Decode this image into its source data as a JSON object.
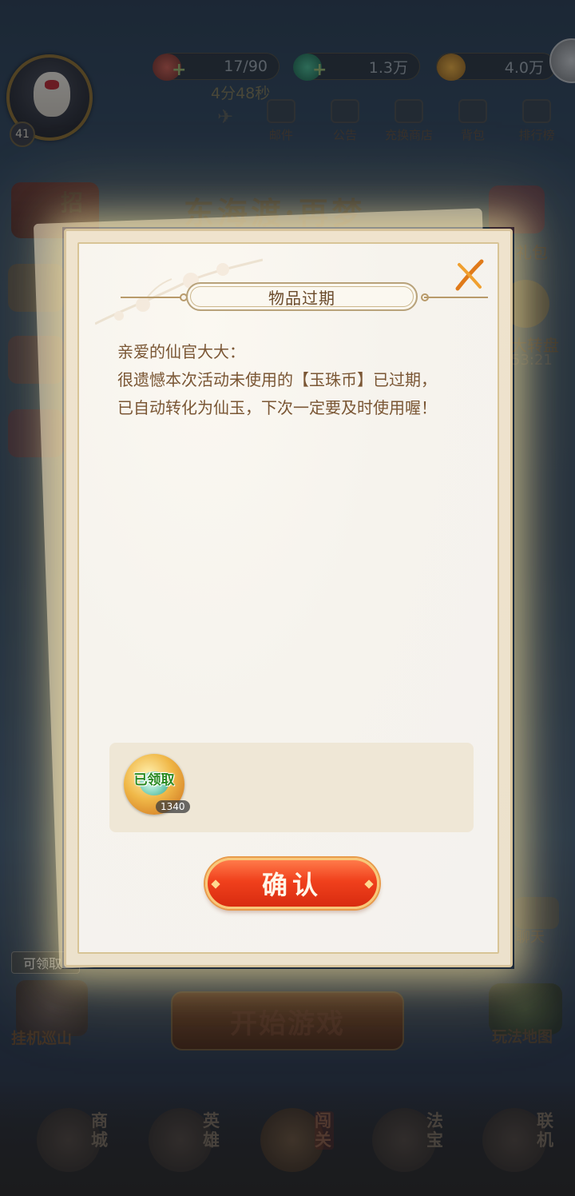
{
  "player": {
    "level": "41"
  },
  "resources": [
    {
      "name": "stamina",
      "value": "17/90",
      "icon": "stamina-icon",
      "color": "#c85a4a"
    },
    {
      "name": "jade",
      "value": "1.3万",
      "icon": "jade-icon",
      "color": "#4ab48a"
    },
    {
      "name": "coin",
      "value": "4.0万",
      "icon": "coin-icon",
      "color": "#e8a838"
    }
  ],
  "stamina_timer": "4分48秒",
  "top_menu": [
    {
      "label": "邮件",
      "icon": "mail-icon"
    },
    {
      "label": "公告",
      "icon": "announcement-icon"
    },
    {
      "label": "充换商店",
      "icon": "exchange-shop-icon"
    },
    {
      "label": "背包",
      "icon": "backpack-icon"
    },
    {
      "label": "排行榜",
      "icon": "leaderboard-icon"
    }
  ],
  "event_banner": {
    "title": "东海渡·再梦"
  },
  "left_side": {
    "recruit_label": "招"
  },
  "right_side": {
    "gift_label": "礼包",
    "wheel_label": "大转盘",
    "wheel_timer": "53:21",
    "chat_label": "聊天"
  },
  "idle": {
    "tag": "可领取",
    "label": "挂机巡山"
  },
  "start_button": "开始游戏",
  "map_label": "玩法地图",
  "bottom_tabs": [
    {
      "label": "商城",
      "icon": "shop-icon",
      "active": false
    },
    {
      "label": "英雄",
      "icon": "hero-icon",
      "active": false
    },
    {
      "label": "闯关",
      "icon": "battle-icon",
      "active": true
    },
    {
      "label": "法宝",
      "icon": "treasure-icon",
      "active": false
    },
    {
      "label": "联机",
      "icon": "multiplayer-icon",
      "active": false
    }
  ],
  "modal": {
    "title": "物品过期",
    "message_lines": [
      "亲爱的仙官大大：",
      "很遗憾本次活动未使用的【玉珠币】已过期，",
      "已自动转化为仙玉，下次一定要及时使用喔！"
    ],
    "reward": {
      "status": "已领取",
      "quantity": "1340",
      "icon": "jade-reward-icon"
    },
    "confirm_label": "确认"
  },
  "colors": {
    "confirm_button": "#f0401c",
    "title_text": "#6a4a2a",
    "message_text": "#7a5634",
    "claimed_text": "#2a8a22"
  }
}
